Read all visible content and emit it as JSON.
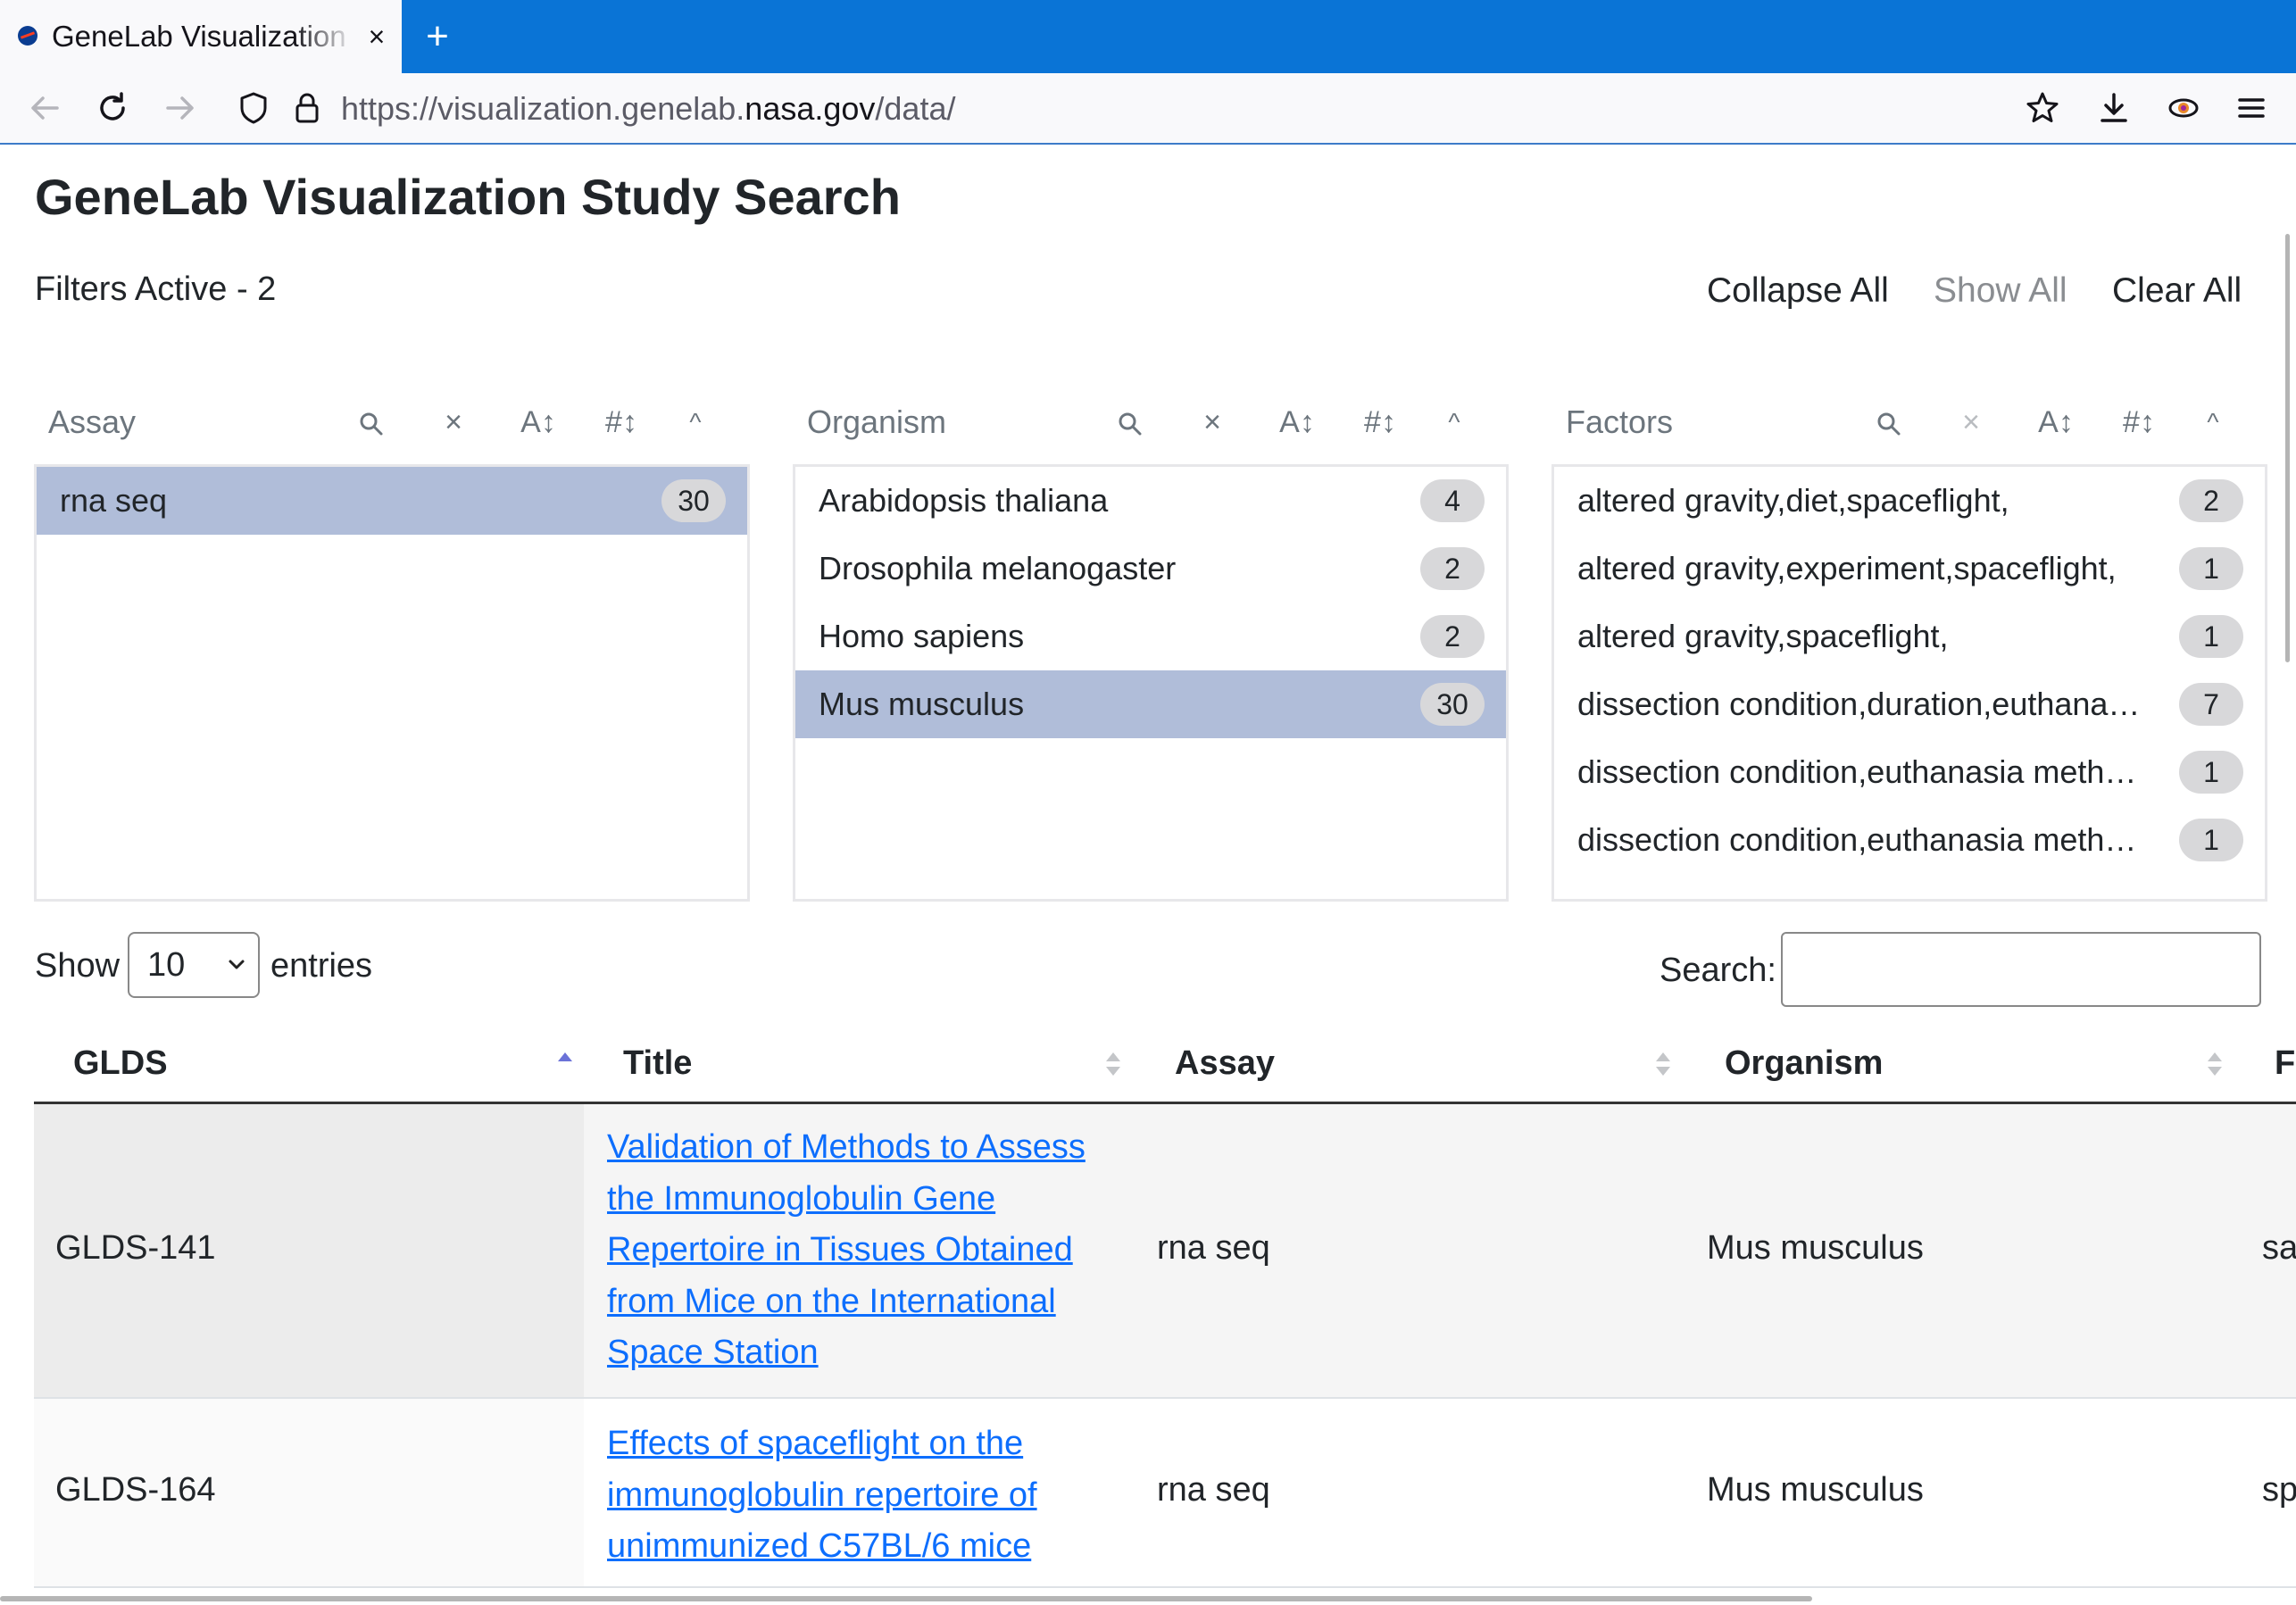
{
  "browser": {
    "tab_title": "GeneLab Visualization Study Search",
    "tab_close": "×",
    "new_tab": "+",
    "url_prefix": "https://visualization.genelab.",
    "url_domain": "nasa.gov",
    "url_path": "/data/"
  },
  "page": {
    "title": "GeneLab Visualization Study Search",
    "filters_active": "Filters Active - 2",
    "collapse_all": "Collapse All",
    "show_all": "Show All",
    "clear_all": "Clear All"
  },
  "filters": {
    "assay": {
      "label": "Assay",
      "items": [
        {
          "text": "rna seq",
          "count": "30",
          "selected": true
        }
      ]
    },
    "organism": {
      "label": "Organism",
      "items": [
        {
          "text": "Arabidopsis thaliana",
          "count": "4",
          "selected": false
        },
        {
          "text": "Drosophila melanogaster",
          "count": "2",
          "selected": false
        },
        {
          "text": "Homo sapiens",
          "count": "2",
          "selected": false
        },
        {
          "text": "Mus musculus",
          "count": "30",
          "selected": true
        }
      ]
    },
    "factors": {
      "label": "Factors",
      "items": [
        {
          "text": "altered gravity,diet,spaceflight,",
          "count": "2",
          "selected": false
        },
        {
          "text": "altered gravity,experiment,spaceflight,",
          "count": "1",
          "selected": false
        },
        {
          "text": "altered gravity,spaceflight,",
          "count": "1",
          "selected": false
        },
        {
          "text": "dissection condition,duration,euthanasia l…",
          "count": "7",
          "selected": false
        },
        {
          "text": "dissection condition,euthanasia method,",
          "count": "1",
          "selected": false
        },
        {
          "text": "dissection condition,euthanasia method,ti…",
          "count": "1",
          "selected": false
        }
      ]
    },
    "icons": {
      "search": "search-icon",
      "clear": "×",
      "sort_alpha": "A↕",
      "sort_num": "#↕",
      "collapse": "^"
    }
  },
  "table_controls": {
    "show_label": "Show",
    "page_length": "10",
    "entries_label": "entries",
    "search_label": "Search:",
    "search_value": ""
  },
  "table": {
    "columns": [
      "GLDS",
      "Title",
      "Assay",
      "Organism",
      "F"
    ],
    "rows": [
      {
        "glds": "GLDS-141",
        "title": "Validation of Methods to Assess the Immunoglobulin Gene Repertoire in Tissues Obtained from Mice on the International Space Station",
        "assay": "rna seq",
        "organism": "Mus musculus",
        "factors": "sa"
      },
      {
        "glds": "GLDS-164",
        "title": "Effects of spaceflight on the immunoglobulin repertoire of unimmunized C57BL/6 mice",
        "assay": "rna seq",
        "organism": "Mus musculus",
        "factors": "sp"
      }
    ]
  },
  "colors": {
    "tabbar": "#0a74d6",
    "selected_row": "#b0bdd9",
    "link": "#0d6efd",
    "sort_active": "#6b72d8"
  }
}
